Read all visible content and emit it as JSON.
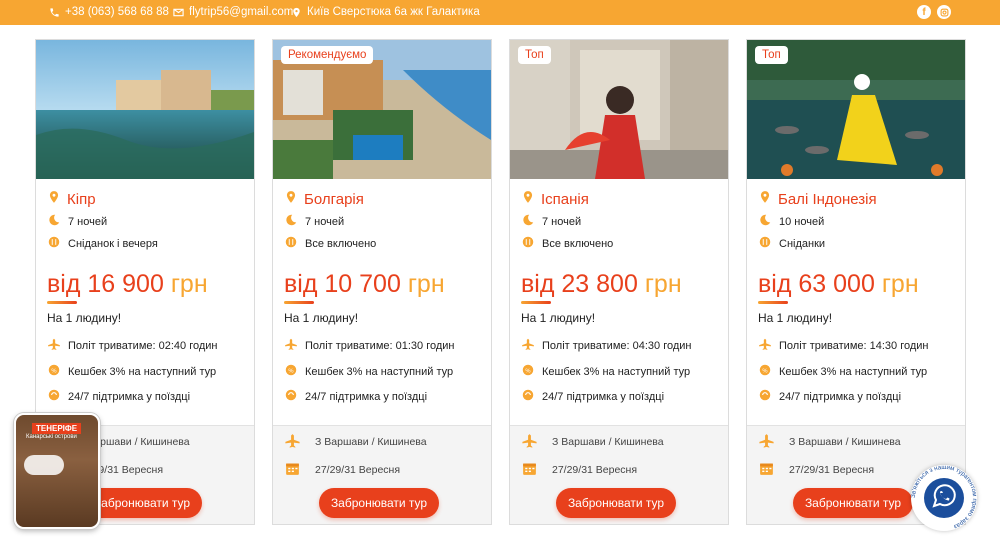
{
  "topbar": {
    "phone": "+38 (063) 568 68 88",
    "email": "flytrip56@gmail.com",
    "address": "Київ Сверстюка 6а жк Галактика",
    "social": [
      "facebook-icon",
      "instagram-icon"
    ]
  },
  "cards": [
    {
      "badge": "",
      "destination": "Кіпр",
      "nights": "7 ночей",
      "meals": "Сніданок і вечеря",
      "price_prefix": "від",
      "price_amount": "16 900",
      "price_currency": "грн",
      "per_person": "На 1 людину!",
      "flight_time": "Політ триватиме: 02:40 годин",
      "cashback": "Кешбек 3% на наступний тур",
      "support": "24/7 підтримка у поїздці",
      "departure": "З Варшави / Кишинева",
      "dates": "27/29/31 Вересня",
      "book_label": "Забронювати тур"
    },
    {
      "badge": "Рекомендуємо",
      "destination": "Болгарія",
      "nights": "7 ночей",
      "meals": "Все включено",
      "price_prefix": "від",
      "price_amount": "10 700",
      "price_currency": "грн",
      "per_person": "На 1 людину!",
      "flight_time": "Політ триватиме: 01:30 годин",
      "cashback": "Кешбек 3% на наступний тур",
      "support": "24/7 підтримка у поїздці",
      "departure": "З Варшави / Кишинева",
      "dates": "27/29/31 Вересня",
      "book_label": "Забронювати тур"
    },
    {
      "badge": "Топ",
      "destination": "Іспанія",
      "nights": "7 ночей",
      "meals": "Все включено",
      "price_prefix": "від",
      "price_amount": "23 800",
      "price_currency": "грн",
      "per_person": "На 1 людину!",
      "flight_time": "Політ триватиме: 04:30 годин",
      "cashback": "Кешбек 3% на наступний тур",
      "support": "24/7 підтримка у поїздці",
      "departure": "З Варшави / Кишинева",
      "dates": "27/29/31 Вересня",
      "book_label": "Забронювати тур"
    },
    {
      "badge": "Топ",
      "destination": "Балі Індонезія",
      "nights": "10 ночей",
      "meals": "Сніданки",
      "price_prefix": "від",
      "price_amount": "63 000",
      "price_currency": "грн",
      "per_person": "На 1 людину!",
      "flight_time": "Політ триватиме: 14:30 годин",
      "cashback": "Кешбек 3% на наступний тур",
      "support": "24/7 підтримка у поїздці",
      "departure": "З Варшави / Кишинева",
      "dates": "27/29/31 Вересня",
      "book_label": "Забронювати тур"
    }
  ],
  "story": {
    "title": "ТЕНЕРІФЕ",
    "subtitle": "Канарські острови"
  },
  "chat_widget": {
    "ring_text": "Зв'яжіться з нашим турагентом прямо зараз"
  },
  "colors": {
    "accent": "#f7a632",
    "primary": "#e8401c",
    "chat": "#1b4e9c"
  }
}
